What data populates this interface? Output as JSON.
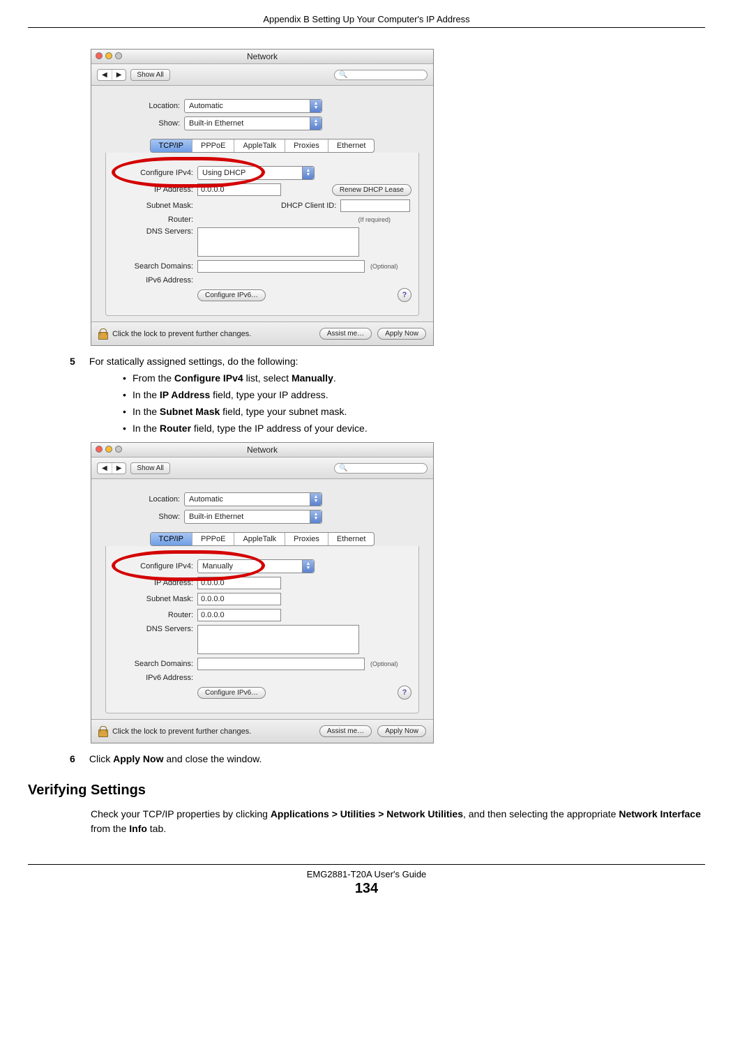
{
  "header": "Appendix B Setting Up Your Computer's IP Address",
  "footer": {
    "title": "EMG2881-T20A User's Guide",
    "page": "134"
  },
  "step5": {
    "num": "5",
    "text": "For statically assigned settings, do the following:",
    "bullets": [
      {
        "pre": "From the ",
        "b": "Configure IPv4",
        "mid": " list, select ",
        "b2": "Manually",
        "post": "."
      },
      {
        "pre": "In the ",
        "b": "IP Address",
        "mid": " field, type your IP address.",
        "b2": "",
        "post": ""
      },
      {
        "pre": "In the ",
        "b": "Subnet Mask",
        "mid": " field, type your subnet mask.",
        "b2": "",
        "post": ""
      },
      {
        "pre": "In the ",
        "b": "Router",
        "mid": " field, type the IP address of your device.",
        "b2": "",
        "post": ""
      }
    ]
  },
  "step6": {
    "num": "6",
    "pre": "Click ",
    "b": "Apply Now",
    "post": " and close the window."
  },
  "verify_heading": "Verifying Settings",
  "verify_para": {
    "t1": "Check your TCP/IP properties by clicking ",
    "b1": "Applications > Utilities > Network Utilities",
    "t2": ", and then selecting the appropriate ",
    "b2": "Network Interface",
    "t3": " from the ",
    "b3": "Info",
    "t4": " tab."
  },
  "mac": {
    "title": "Network",
    "nav_back": "◀",
    "nav_fwd": "▶",
    "show_all": "Show All",
    "location_label": "Location:",
    "location_value": "Automatic",
    "show_label": "Show:",
    "show_value": "Built-in Ethernet",
    "tabs": [
      "TCP/IP",
      "PPPoE",
      "AppleTalk",
      "Proxies",
      "Ethernet"
    ],
    "cfg_label": "Configure IPv4:",
    "ip_label": "IP Address:",
    "subnet_label": "Subnet Mask:",
    "router_label": "Router:",
    "dns_label": "DNS Servers:",
    "search_label": "Search Domains:",
    "ipv6_label": "IPv6 Address:",
    "dhcpid_label": "DHCP Client ID:",
    "if_required": "(If required)",
    "optional": "(Optional)",
    "renew": "Renew DHCP Lease",
    "cfg_ipv6_btn": "Configure IPv6…",
    "lock_text": "Click the lock to prevent further changes.",
    "assist": "Assist me…",
    "apply": "Apply Now",
    "help": "?"
  },
  "win1": {
    "cfg_value": "Using DHCP",
    "ip": "0.0.0.0",
    "subnet": "",
    "router": ""
  },
  "win2": {
    "cfg_value": "Manually",
    "ip": "0.0.0.0",
    "subnet": "0.0.0.0",
    "router": "0.0.0.0"
  }
}
